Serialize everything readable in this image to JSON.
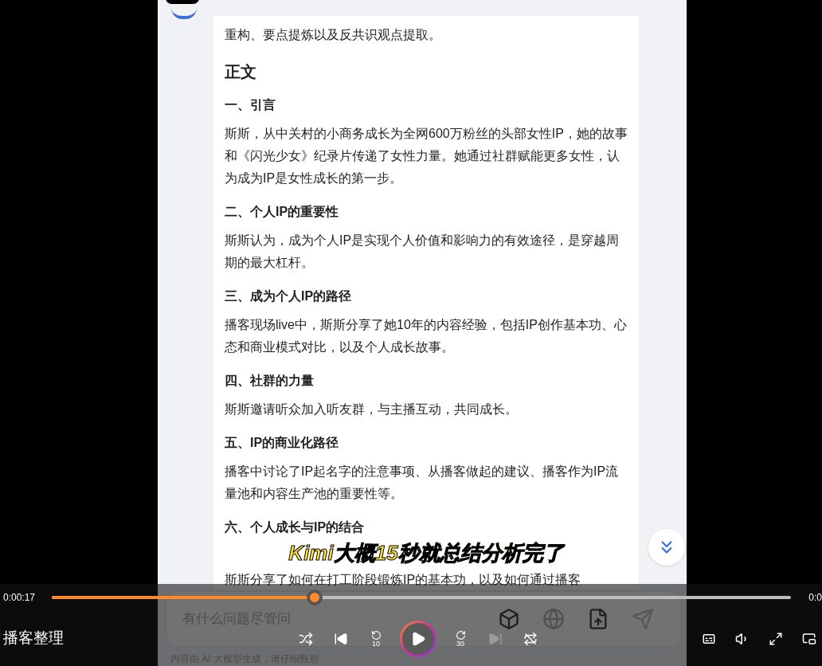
{
  "article": {
    "intro_tail": "重构、要点提炼以及反共识观点提取。",
    "section_title": "正文",
    "sections": [
      {
        "heading": "一、引言",
        "body": "斯斯，从中关村的小商务成长为全网600万粉丝的头部女性IP，她的故事和《闪光少女》纪录片传递了女性力量。她通过社群赋能更多女性，认为成为IP是女性成长的第一步。"
      },
      {
        "heading": "二、个人IP的重要性",
        "body": "斯斯认为，成为个人IP是实现个人价值和影响力的有效途径，是穿越周期的最大杠杆。"
      },
      {
        "heading": "三、成为个人IP的路径",
        "body": "播客现场live中，斯斯分享了她10年的内容经验，包括IP创作基本功、心态和商业模式对比，以及个人成长故事。"
      },
      {
        "heading": "四、社群的力量",
        "body": "斯斯邀请听众加入听友群，与主播互动，共同成长。"
      },
      {
        "heading": "五、IP的商业化路径",
        "body": "播客中讨论了IP起名字的注意事项、从播客做起的建议、播客作为IP流量池和内容生产池的重要性等。"
      },
      {
        "heading": "六、个人成长与IP的结合",
        "body": "斯斯分享了如何在打工阶段锻炼IP的基本功，以及如何通过播客"
      }
    ]
  },
  "subtitle": "Kimi大概15秒就总结分析完了",
  "chat_input": {
    "placeholder": "有什么问题尽管问",
    "disclaimer": "内容由 AI 大模型生成，请仔细甄别"
  },
  "player": {
    "elapsed": "0:00:17",
    "total": "0:0",
    "level": 0.353,
    "title": "播客整理",
    "rewind_label": "10",
    "forward_label": "30",
    "next_disabled": true,
    "playing": false
  }
}
